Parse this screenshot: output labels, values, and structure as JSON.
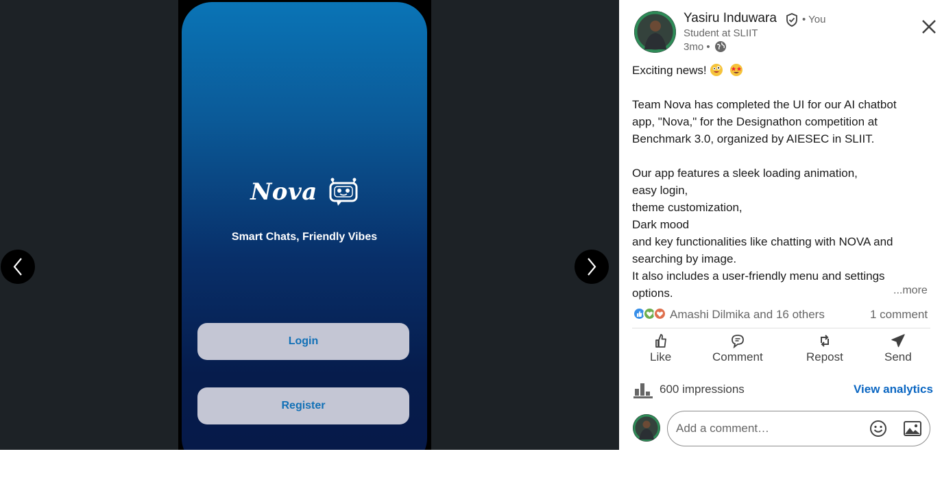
{
  "viewer": {
    "app_name": "Nova",
    "tagline": "Smart Chats, Friendly Vibes",
    "login_label": "Login",
    "register_label": "Register"
  },
  "post": {
    "author_name": "Yasiru Induwara",
    "you_label": "• You",
    "headline": "Student at SLIIT",
    "time": "3mo •",
    "body_lines": [
      "Exciting news!",
      "",
      "Team Nova has completed the UI for our AI chatbot",
      "app, \"Nova,\" for the Designathon competition at",
      "Benchmark 3.0, organized by AIESEC in SLIIT.",
      "",
      "Our app features a sleek loading animation,",
      "easy login,",
      "theme customization,",
      "Dark mood",
      "and key functionalities like chatting with NOVA and",
      "searching by image.",
      "It also includes a user-friendly menu and settings",
      "options."
    ],
    "more_label": "...more",
    "reactions_text": "Amashi Dilmika and 16 others",
    "comment_count": "1 comment"
  },
  "actions": {
    "like": "Like",
    "comment": "Comment",
    "repost": "Repost",
    "send": "Send"
  },
  "stats": {
    "impressions": "600 impressions",
    "analytics_label": "View analytics"
  },
  "comment_input": {
    "placeholder": "Add a comment…"
  },
  "colors": {
    "accent": "#0a66c2",
    "viewer_bg": "#1d2226",
    "app_button_bg": "#c4c6d4",
    "app_button_text": "#1170b6"
  },
  "icons": [
    "chevron-left-icon",
    "chevron-right-icon",
    "close-icon",
    "verified-icon",
    "globe-icon",
    "like-icon",
    "comment-icon",
    "repost-icon",
    "send-icon",
    "bar-chart-icon",
    "emoji-icon",
    "image-icon"
  ]
}
